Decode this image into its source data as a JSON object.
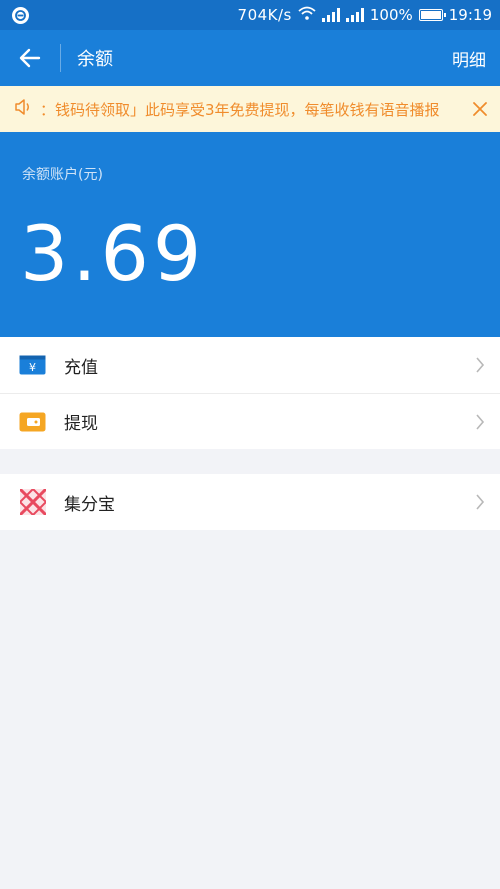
{
  "status_bar": {
    "net_speed": "704K/s",
    "battery_pct": "100%",
    "time": "19:19",
    "icons": [
      "app-notification-icon",
      "wifi-icon",
      "signal-icon",
      "signal-icon",
      "battery-icon"
    ]
  },
  "app_bar": {
    "title": "余额",
    "detail_label": "明细"
  },
  "notice": {
    "text": "：钱码待领取」此码享受3年免费提现，每笔收钱有语音播报",
    "color": "#f08c2c",
    "background": "#fdf6da"
  },
  "balance": {
    "label": "余额账户(元)",
    "amount": "3.69"
  },
  "menu": {
    "group1": [
      {
        "label": "充值",
        "icon": "recharge-icon",
        "icon_color": "#1a7fd9"
      },
      {
        "label": "提现",
        "icon": "withdraw-wallet-icon",
        "icon_color": "#f5a623"
      }
    ],
    "group2": [
      {
        "label": "集分宝",
        "icon": "jifenbao-icon",
        "icon_color": "#e84a5f"
      }
    ]
  },
  "colors": {
    "primary": "#1a7fd9",
    "status_bar": "#1670c6",
    "background": "#f2f3f7"
  }
}
